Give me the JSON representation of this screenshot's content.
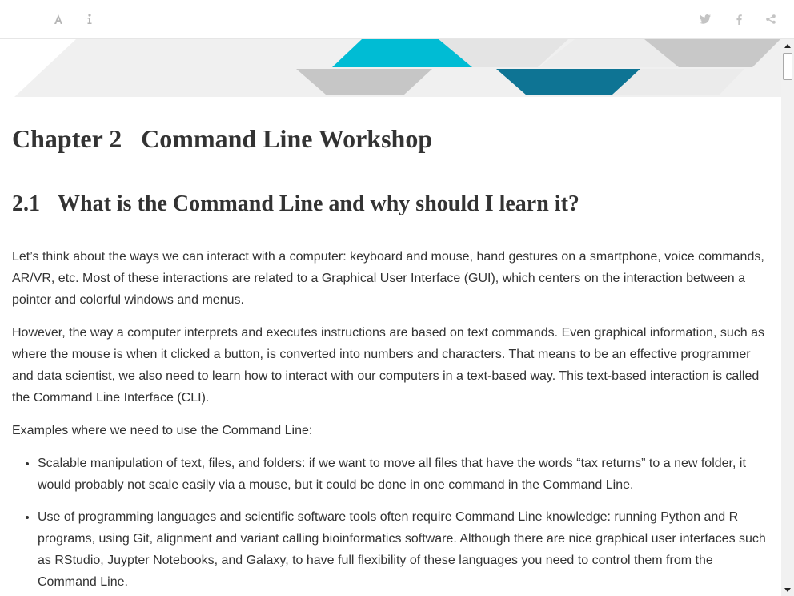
{
  "toolbar": {
    "left_icons": [
      "font-settings-icon",
      "info-icon"
    ],
    "right_icons": [
      "twitter-icon",
      "facebook-icon",
      "share-icon"
    ],
    "icon_color": "#b5b5b5"
  },
  "banner": {
    "colors": [
      "#efefef",
      "#00bcd4",
      "#c8c8c8",
      "#0e7494",
      "#e5e5e5"
    ]
  },
  "chapter": {
    "number": "Chapter 2",
    "title": "Command Line Workshop"
  },
  "section": {
    "number": "2.1",
    "title": "What is the Command Line and why should I learn it?"
  },
  "paragraphs": [
    "Let’s think about the ways we can interact with a computer: keyboard and mouse, hand gestures on a smartphone, voice commands, AR/VR, etc. Most of these interactions are related to a Graphical User Interface (GUI), which centers on the interaction between a pointer and colorful windows and menus.",
    "However, the way a computer interprets and executes instructions are based on text commands. Even graphical information, such as where the mouse is when it clicked a button, is converted into numbers and characters. That means to be an effective programmer and data scientist, we also need to learn how to interact with our computers in a text-based way. This text-based interaction is called the Command Line Interface (CLI).",
    "Examples where we need to use the Command Line:"
  ],
  "list_items": [
    "Scalable manipulation of text, files, and folders: if we want to move all files that have the words “tax returns” to a new folder, it would probably not scale easily via a mouse, but it could be done in one command in the Command Line.",
    "Use of programming languages and scientific software tools often require Command Line knowledge: running Python and R programs, using Git, alignment and variant calling bioinformatics software. Although there are nice graphical user interfaces such as RStudio, Juypter Notebooks, and Galaxy, to have full flexibility of these languages you need to control them from the Command Line."
  ]
}
